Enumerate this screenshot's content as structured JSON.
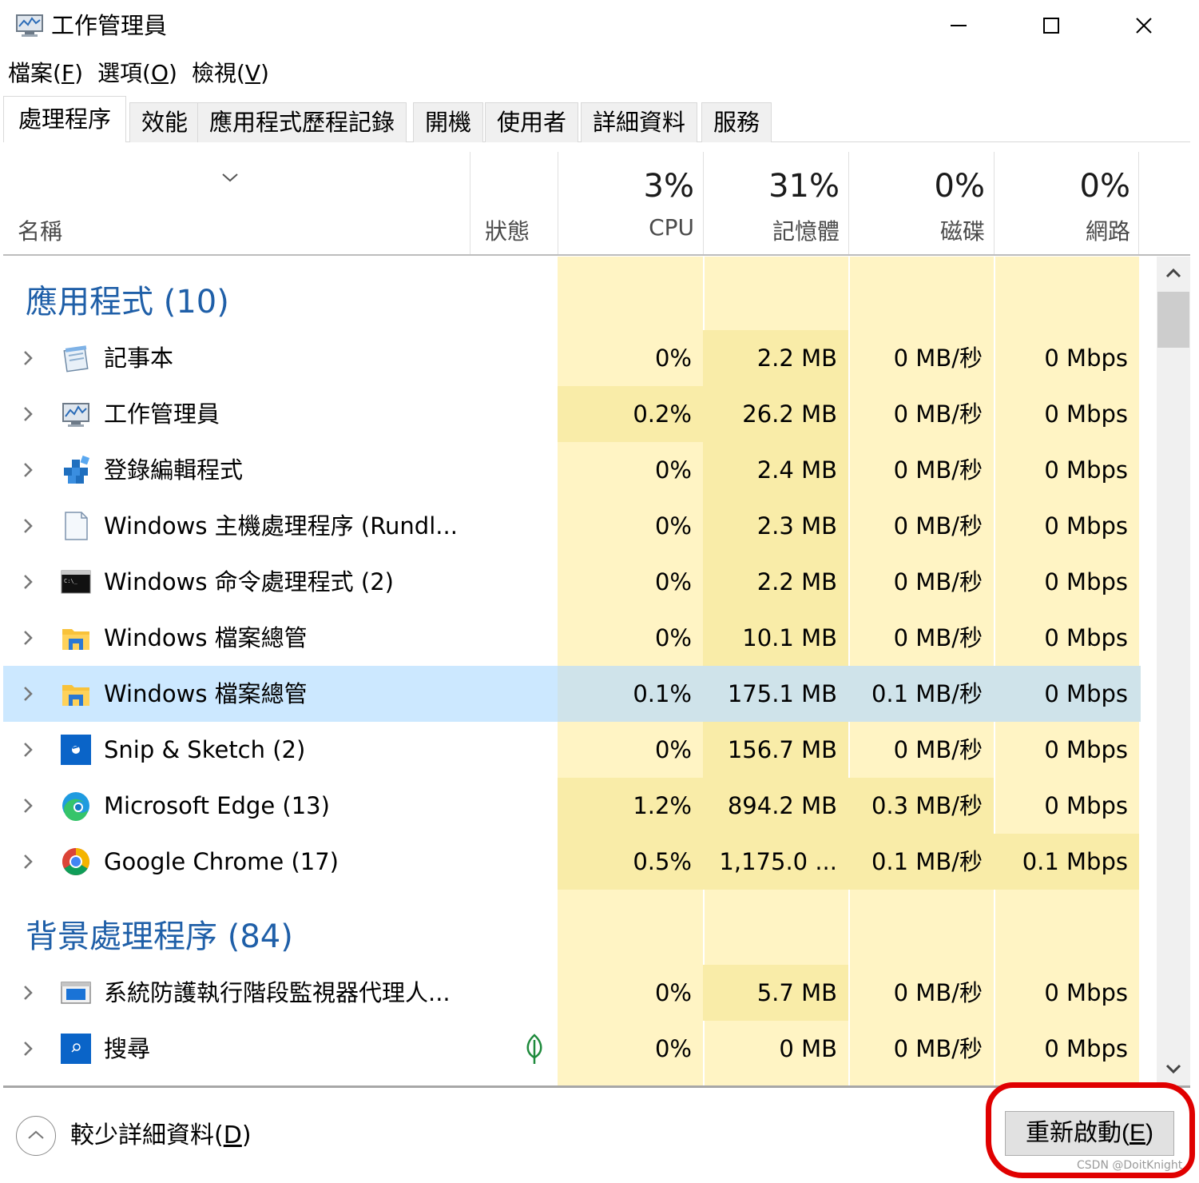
{
  "window": {
    "title": "工作管理員",
    "icon": "task-manager-icon"
  },
  "menu": [
    {
      "label": "檔案",
      "key": "F"
    },
    {
      "label": "選項",
      "key": "O"
    },
    {
      "label": "檢視",
      "key": "V"
    }
  ],
  "tabs": [
    {
      "label": "處理程序",
      "active": true
    },
    {
      "label": "效能"
    },
    {
      "label": "應用程式歷程記錄"
    },
    {
      "label": "開機"
    },
    {
      "label": "使用者"
    },
    {
      "label": "詳細資料"
    },
    {
      "label": "服務"
    }
  ],
  "header": {
    "name": "名稱",
    "status": "狀態",
    "cpu": {
      "pct": "3%",
      "label": "CPU"
    },
    "memory": {
      "pct": "31%",
      "label": "記憶體"
    },
    "disk": {
      "pct": "0%",
      "label": "磁碟"
    },
    "network": {
      "pct": "0%",
      "label": "網路"
    }
  },
  "groups": [
    {
      "title": "應用程式 (10)",
      "rows": [
        {
          "name": "記事本",
          "icon": "notepad-icon",
          "cpu": "0%",
          "mem": "2.2 MB",
          "disk": "0 MB/秒",
          "net": "0 Mbps"
        },
        {
          "name": "工作管理員",
          "icon": "task-manager-icon",
          "cpu": "0.2%",
          "mem": "26.2 MB",
          "disk": "0 MB/秒",
          "net": "0 Mbps"
        },
        {
          "name": "登錄編輯程式",
          "icon": "registry-editor-icon",
          "cpu": "0%",
          "mem": "2.4 MB",
          "disk": "0 MB/秒",
          "net": "0 Mbps"
        },
        {
          "name": "Windows 主機處理程序 (Rundl...",
          "icon": "blank-document-icon",
          "cpu": "0%",
          "mem": "2.3 MB",
          "disk": "0 MB/秒",
          "net": "0 Mbps"
        },
        {
          "name": "Windows 命令處理程式 (2)",
          "icon": "command-prompt-icon",
          "cpu": "0%",
          "mem": "2.2 MB",
          "disk": "0 MB/秒",
          "net": "0 Mbps"
        },
        {
          "name": "Windows 檔案總管",
          "icon": "file-explorer-icon",
          "cpu": "0%",
          "mem": "10.1 MB",
          "disk": "0 MB/秒",
          "net": "0 Mbps"
        },
        {
          "name": "Windows 檔案總管",
          "icon": "file-explorer-icon",
          "cpu": "0.1%",
          "mem": "175.1 MB",
          "disk": "0.1 MB/秒",
          "net": "0 Mbps",
          "selected": true
        },
        {
          "name": "Snip & Sketch (2)",
          "icon": "snip-sketch-icon",
          "cpu": "0%",
          "mem": "156.7 MB",
          "disk": "0 MB/秒",
          "net": "0 Mbps"
        },
        {
          "name": "Microsoft Edge (13)",
          "icon": "edge-icon",
          "cpu": "1.2%",
          "mem": "894.2 MB",
          "disk": "0.3 MB/秒",
          "net": "0 Mbps"
        },
        {
          "name": "Google Chrome (17)",
          "icon": "chrome-icon",
          "cpu": "0.5%",
          "mem": "1,175.0 ...",
          "disk": "0.1 MB/秒",
          "net": "0.1 Mbps"
        }
      ]
    },
    {
      "title": "背景處理程序 (84)",
      "rows": [
        {
          "name": "系統防護執行階段監視器代理人...",
          "icon": "system-guard-icon",
          "cpu": "0%",
          "mem": "5.7 MB",
          "disk": "0 MB/秒",
          "net": "0 Mbps"
        },
        {
          "name": "搜尋",
          "icon": "search-icon",
          "cpu": "0%",
          "mem": "0 MB",
          "disk": "0 MB/秒",
          "net": "0 Mbps",
          "status_icon": "leaf-icon"
        }
      ]
    }
  ],
  "footer": {
    "fewer_details": "較少詳細資料",
    "fewer_details_key": "D",
    "restart": "重新啟動",
    "restart_key": "E",
    "watermark": "CSDN @DoitKnight"
  },
  "colors": {
    "heat_light": "#fff4c4",
    "heat_medium": "#f9eca8",
    "selected_row": "#cce8ff",
    "group_title": "#1f5fa8",
    "annotation_red": "#e00000"
  }
}
